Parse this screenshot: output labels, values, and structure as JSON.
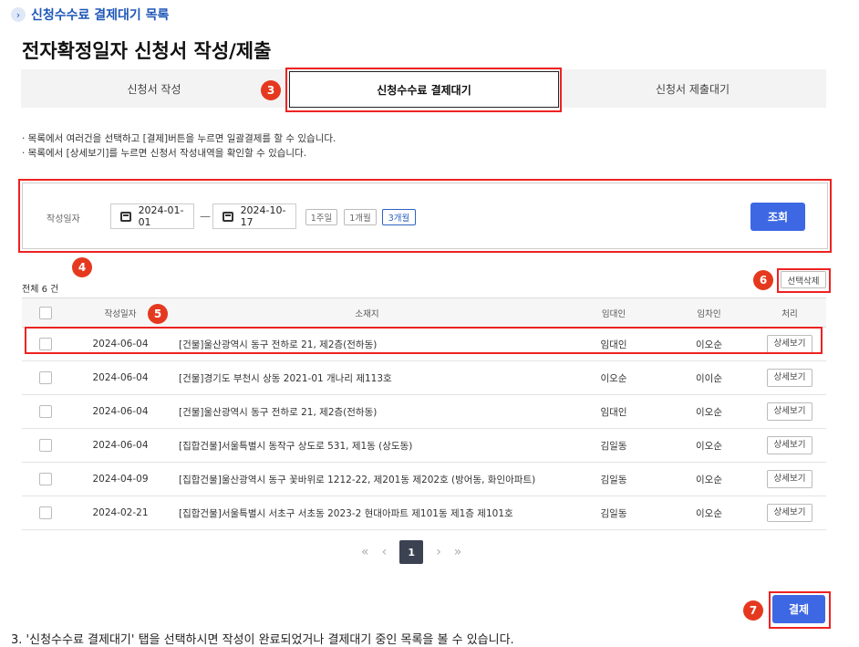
{
  "breadcrumb": {
    "icon": "chevron-right-icon",
    "text": "신청수수료 결제대기 목록"
  },
  "page_title": "전자확정일자 신청서 작성/제출",
  "tabs": [
    {
      "label": "신청서 작성",
      "active": false
    },
    {
      "label": "신청수수료 결제대기",
      "active": true
    },
    {
      "label": "신청서 제출대기",
      "active": false
    }
  ],
  "notes": [
    "· 목록에서 여러건을 선택하고 [결제]버튼을 누르면 일괄결제를 할 수 있습니다.",
    "· 목록에서 [상세보기]를 누르면 신청서 작성내역을 확인할 수 있습니다."
  ],
  "filter": {
    "label": "작성일자",
    "start_date": "2024-01-01",
    "separator": "—",
    "end_date": "2024-10-17",
    "periods": [
      "1주일",
      "1개월",
      "3개월"
    ],
    "selected_period": "3개월",
    "search_label": "조회"
  },
  "list": {
    "total": "전체 6 건",
    "delete_label": "선택삭제",
    "columns": [
      "작성일자",
      "소재지",
      "임대인",
      "임차인",
      "처리"
    ],
    "detail_label": "상세보기",
    "rows": [
      {
        "date": "2024-06-04",
        "address": "[건물]울산광역시 동구 전하로 21, 제2층(전하동)",
        "landlord": "임대인",
        "tenant": "이오순"
      },
      {
        "date": "2024-06-04",
        "address": "[건물]경기도 부천시 상동 2021-01 개나리 제113호",
        "landlord": "이오순",
        "tenant": "이이순"
      },
      {
        "date": "2024-06-04",
        "address": "[건물]울산광역시 동구 전하로 21, 제2층(전하동)",
        "landlord": "임대인",
        "tenant": "이오순"
      },
      {
        "date": "2024-06-04",
        "address": "[집합건물]서울특별시 동작구 상도로 531, 제1동 (상도동)",
        "landlord": "김일동",
        "tenant": "이오순"
      },
      {
        "date": "2024-04-09",
        "address": "[집합건물]울산광역시 동구 꽃바위로 1212-22, 제201동 제202호 (방어동, 화인아파트)",
        "landlord": "김일동",
        "tenant": "이오순"
      },
      {
        "date": "2024-02-21",
        "address": "[집합건물]서울특별시 서초구 서초동 2023-2 현대아파트 제101동 제1층 제101호",
        "landlord": "김일동",
        "tenant": "이오순"
      }
    ]
  },
  "pagination": {
    "first": "«",
    "prev": "‹",
    "current": "1",
    "next": "›",
    "last": "»"
  },
  "pay_label": "결제",
  "annotations": [
    "3",
    "4",
    "5",
    "6",
    "7"
  ],
  "bottom_note": "3. '신청수수료 결제대기' 탭을 선택하시면 작성이 완료되었거나 결제대기 중인 목록을 볼 수 있습니다.",
  "colors": {
    "accent": "#3e68e3",
    "highlight": "#e22222",
    "badge": "#e5391f"
  }
}
